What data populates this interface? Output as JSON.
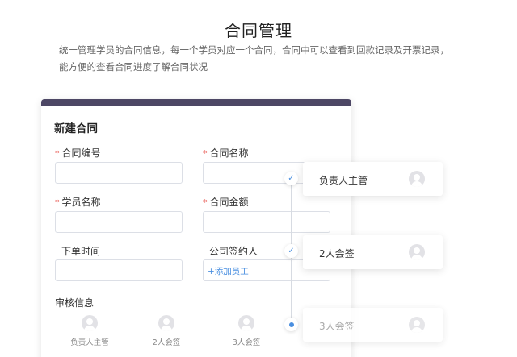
{
  "page": {
    "title": "合同管理",
    "description": "统一管理学员的合同信息，每一个学员对应一个合同，合同中可以查看到回款记录及开票记录，能方便的查看合同进度了解合同状况"
  },
  "form": {
    "title": "新建合同",
    "fields": {
      "contract_number": {
        "label": "合同编号",
        "required": "*",
        "value": ""
      },
      "contract_name": {
        "label": "合同名称",
        "required": "*",
        "value": ""
      },
      "student_name": {
        "label": "学员名称",
        "required": "*",
        "value": ""
      },
      "contract_amount": {
        "label": "合同金额",
        "required": "*",
        "value": ""
      },
      "order_time": {
        "label": "下单时间",
        "value": ""
      },
      "signer": {
        "label": "公司签约人",
        "add_link": "+添加员工"
      }
    },
    "review": {
      "title": "审核信息",
      "reviewers": [
        {
          "label": "负责人主管"
        },
        {
          "label": "2人会签"
        },
        {
          "label": "3人会签"
        }
      ]
    }
  },
  "flow": {
    "steps": [
      {
        "label": "负责人主管",
        "status": "done",
        "icon": "check-icon"
      },
      {
        "label": "2人会签",
        "status": "done",
        "icon": "check-icon"
      },
      {
        "label": "3人会签",
        "status": "current",
        "icon": "dot-icon"
      }
    ]
  },
  "colors": {
    "header_bar": "#4d4765",
    "accent": "#4a8fe0",
    "required": "#e8554e"
  }
}
